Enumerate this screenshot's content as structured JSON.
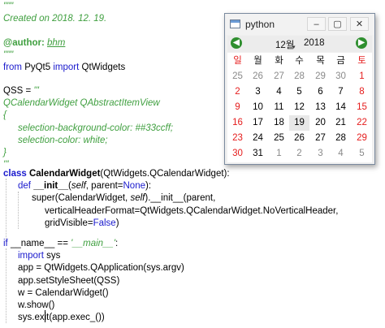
{
  "code": {
    "lines": [
      "\"\"\"",
      "Created on 2018. 12. 19.",
      "",
      "@author: ",
      "bhm",
      "\"\"\"",
      "from",
      " PyQt5 ",
      "import",
      " QtWidgets",
      "",
      "QSS = ",
      "'''",
      "QCalendarWidget QAbstractItemView",
      "{",
      "selection-background-color: ##33ccff;",
      "selection-color: white;",
      "}",
      "'''",
      "class",
      "CalendarWidget",
      "(QtWidgets.QCalendarWidget):",
      "def",
      "__init__",
      "(",
      "self",
      ", parent=",
      "None",
      "):",
      "super(CalendarWidget, ",
      "self",
      ").__init__(parent,",
      "verticalHeaderFormat=QtWidgets.QCalendarWidget.NoVerticalHeader,",
      "gridVisible=",
      "False",
      ")",
      "if",
      " __name__ == ",
      "'__main__'",
      ":",
      "import",
      " sys",
      "app = QtWidgets.QApplication(sys.argv)",
      "app.setStyleSheet(QSS)",
      "w = CalendarWidget()",
      "w.show()",
      "sys.exit(app.exec_())"
    ]
  },
  "window": {
    "title": "python",
    "minimize": "–",
    "maximize": "▢",
    "close": "✕",
    "prev": "◀",
    "next": "▶",
    "month": "12월",
    "month_dropdown": "▾",
    "year": "2018",
    "weekdays": [
      "일",
      "월",
      "화",
      "수",
      "목",
      "금",
      "토"
    ],
    "weeks": [
      [
        "25",
        "26",
        "27",
        "28",
        "29",
        "30",
        "1"
      ],
      [
        "2",
        "3",
        "4",
        "5",
        "6",
        "7",
        "8"
      ],
      [
        "9",
        "10",
        "11",
        "12",
        "13",
        "14",
        "15"
      ],
      [
        "16",
        "17",
        "18",
        "19",
        "20",
        "21",
        "22"
      ],
      [
        "23",
        "24",
        "25",
        "26",
        "27",
        "28",
        "29"
      ],
      [
        "30",
        "31",
        "1",
        "2",
        "3",
        "4",
        "5"
      ]
    ],
    "selected_day": "19"
  },
  "colors": {
    "comment": "#3f9f3f",
    "keyword": "#1a1acd",
    "weekend": "#e51c1c",
    "other_month": "#8a8a8a",
    "nav_button": "#2f8f2f"
  }
}
